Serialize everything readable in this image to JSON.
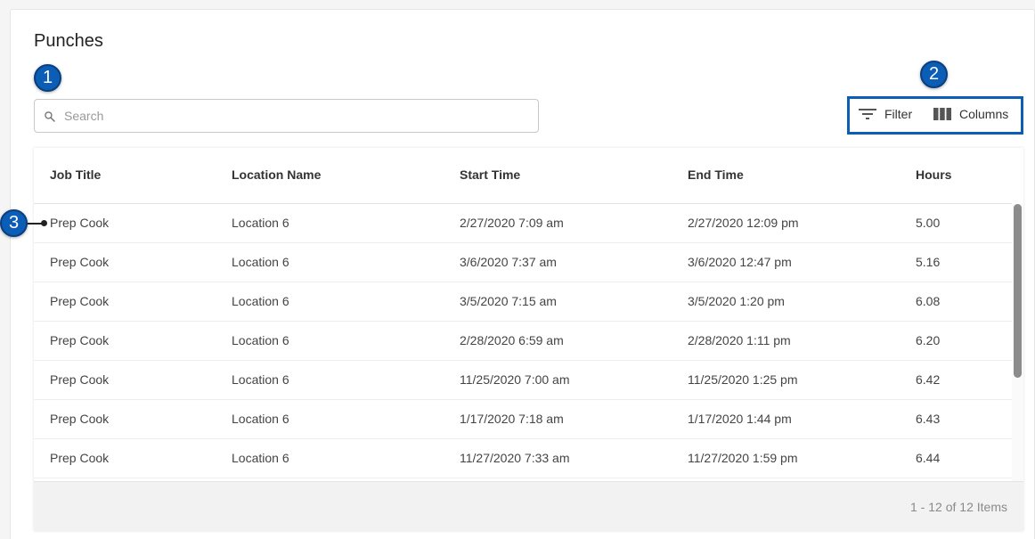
{
  "page": {
    "title": "Punches"
  },
  "callouts": [
    "1",
    "2",
    "3"
  ],
  "search": {
    "placeholder": "Search",
    "value": ""
  },
  "toolbar": {
    "filter_label": "Filter",
    "columns_label": "Columns"
  },
  "table": {
    "columns": [
      "Job Title",
      "Location Name",
      "Start Time",
      "End Time",
      "Hours"
    ],
    "rows": [
      [
        "Prep Cook",
        "Location 6",
        "2/27/2020 7:09 am",
        "2/27/2020 12:09 pm",
        "5.00"
      ],
      [
        "Prep Cook",
        "Location 6",
        "3/6/2020 7:37 am",
        "3/6/2020 12:47 pm",
        "5.16"
      ],
      [
        "Prep Cook",
        "Location 6",
        "3/5/2020 7:15 am",
        "3/5/2020 1:20 pm",
        "6.08"
      ],
      [
        "Prep Cook",
        "Location 6",
        "2/28/2020 6:59 am",
        "2/28/2020 1:11 pm",
        "6.20"
      ],
      [
        "Prep Cook",
        "Location 6",
        "11/25/2020 7:00 am",
        "11/25/2020 1:25 pm",
        "6.42"
      ],
      [
        "Prep Cook",
        "Location 6",
        "1/17/2020 7:18 am",
        "1/17/2020 1:44 pm",
        "6.43"
      ],
      [
        "Prep Cook",
        "Location 6",
        "11/27/2020 7:33 am",
        "11/27/2020 1:59 pm",
        "6.44"
      ]
    ]
  },
  "pagination": {
    "summary": "1 - 12 of 12 Items"
  },
  "icons": {
    "search": "search-icon",
    "filter": "filter-icon",
    "columns": "columns-icon"
  },
  "colors": {
    "accent": "#0b5db6",
    "scrollbar": "#8c8c8c"
  }
}
